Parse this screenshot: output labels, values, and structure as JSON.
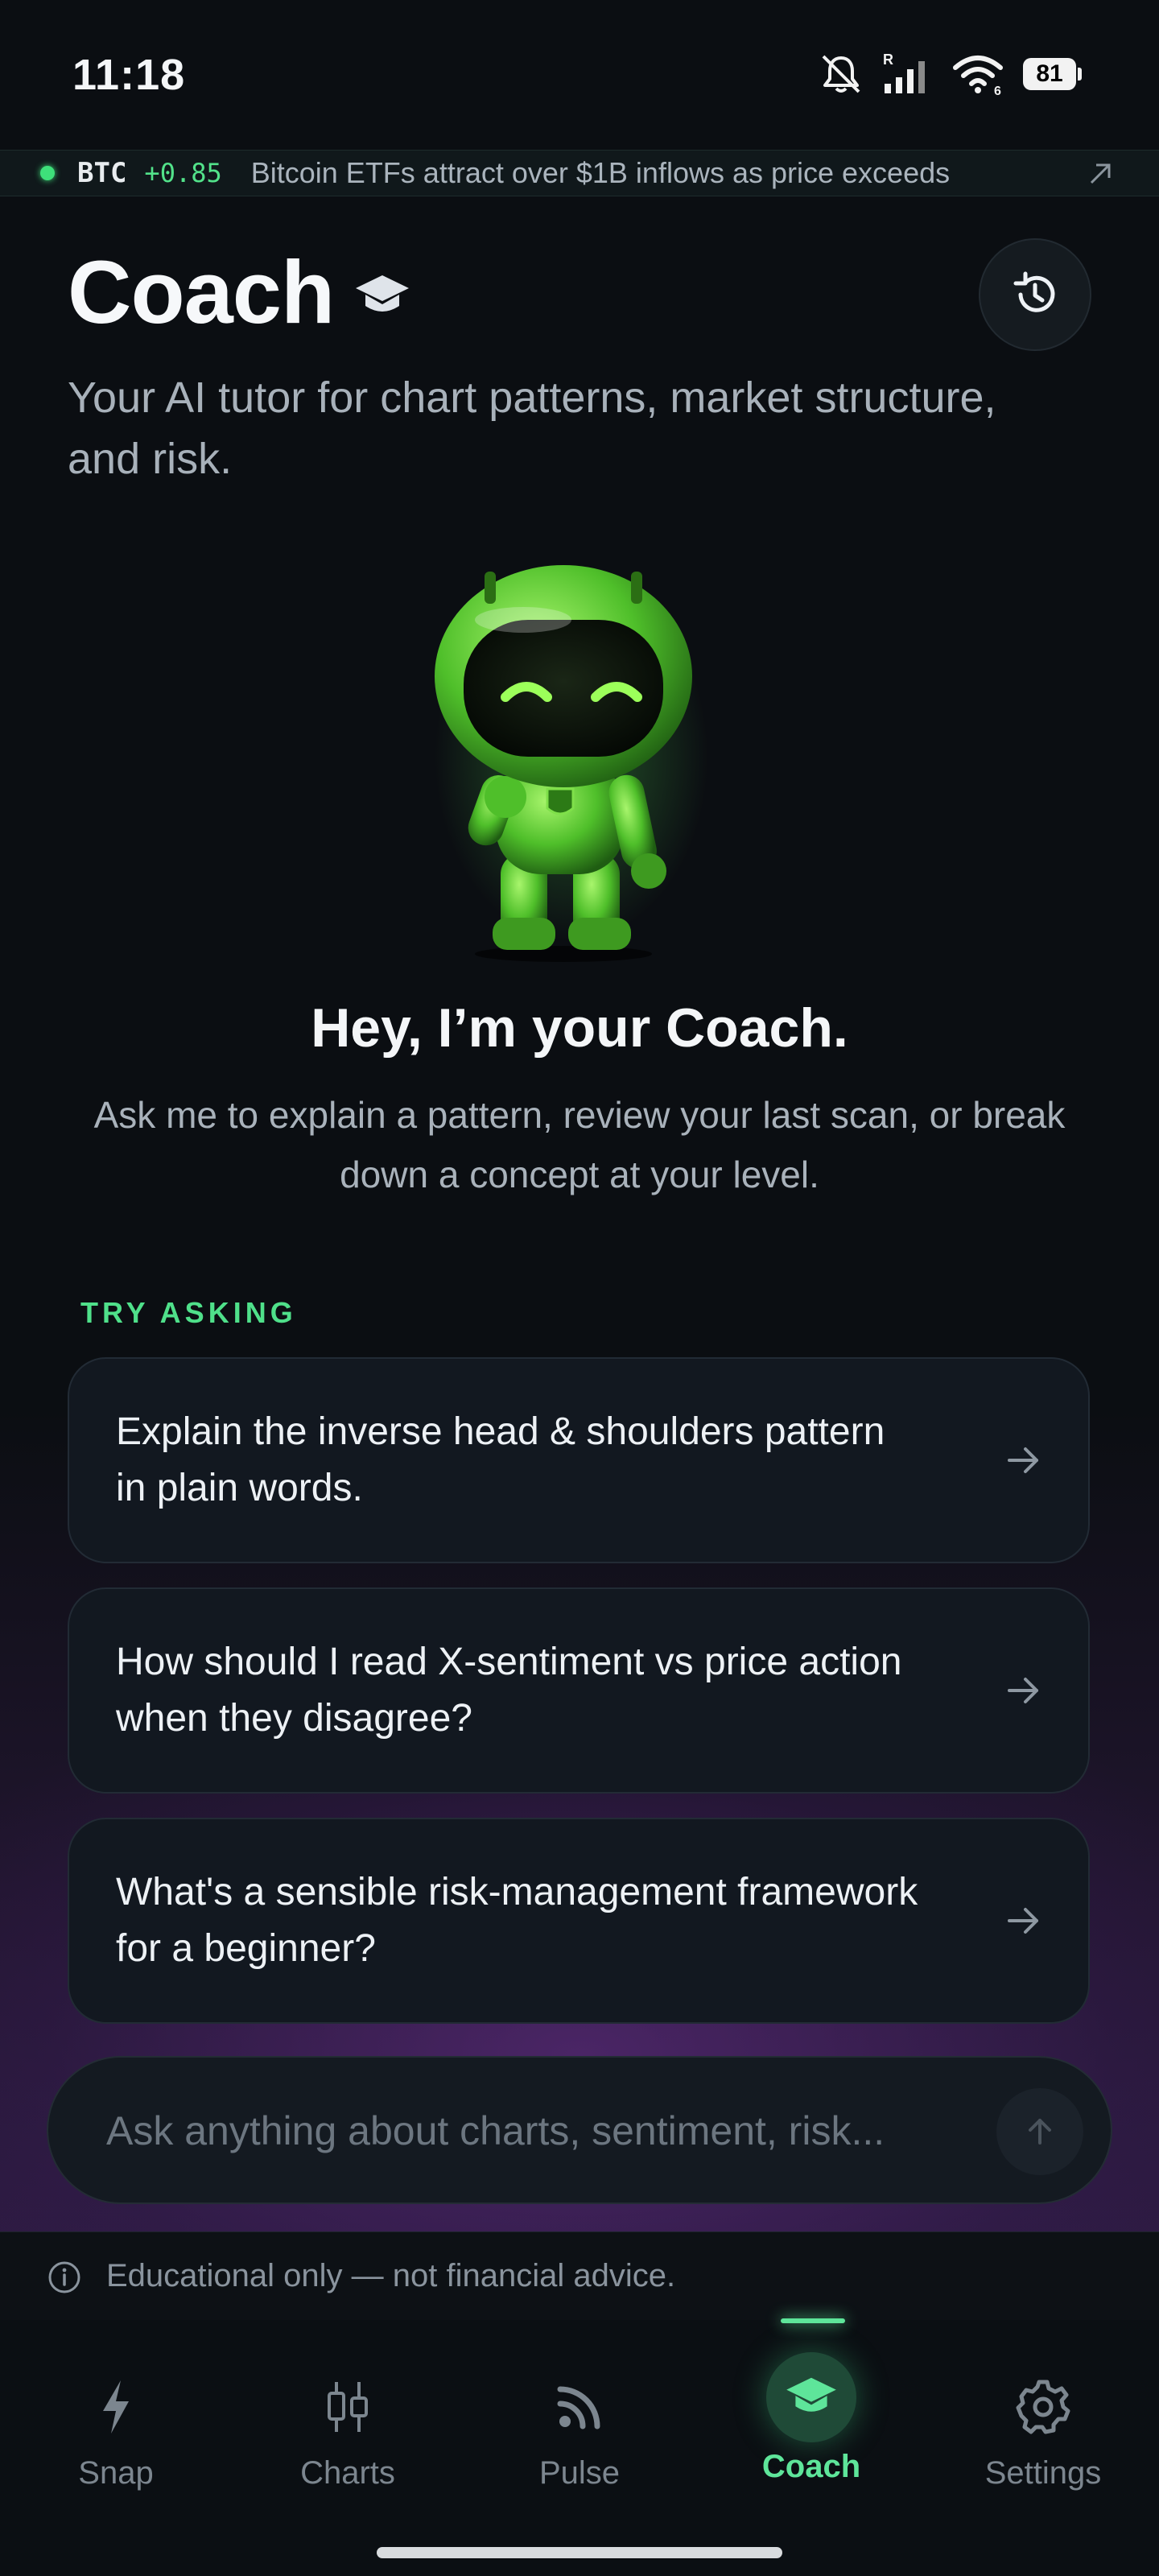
{
  "status_bar": {
    "time": "11:18",
    "battery": "81",
    "signal_tag": "R",
    "wifi_tag": "6"
  },
  "ticker": {
    "symbol": "BTC",
    "change": "+0.85",
    "headline": "Bitcoin ETFs attract over $1B inflows as price exceeds"
  },
  "header": {
    "title": "Coach",
    "subtitle": "Your AI tutor for chart patterns, market structure, and risk."
  },
  "intro": {
    "heading": "Hey, I’m your Coach.",
    "text": "Ask me to explain a pattern, review your last scan, or break down a concept at your level."
  },
  "suggestions": {
    "label": "TRY ASKING",
    "items": [
      {
        "text": "Explain the inverse head & shoulders pattern in plain words."
      },
      {
        "text": "How should I read X-sentiment vs price action when they disagree?"
      },
      {
        "text": "What's a sensible risk-management framework for a beginner?"
      }
    ]
  },
  "composer": {
    "placeholder": "Ask anything about charts, sentiment, risk..."
  },
  "disclaimer": "Educational only — not financial advice.",
  "nav": {
    "items": [
      {
        "label": "Snap",
        "icon": "bolt-icon"
      },
      {
        "label": "Charts",
        "icon": "candlestick-icon"
      },
      {
        "label": "Pulse",
        "icon": "rss-icon"
      },
      {
        "label": "Coach",
        "icon": "graduation-cap-icon",
        "active": true
      },
      {
        "label": "Settings",
        "icon": "gear-icon"
      }
    ]
  },
  "colors": {
    "accent": "#4fe08a",
    "background": "#0b0e12",
    "card": "#121820",
    "glow": "#3a2054"
  }
}
